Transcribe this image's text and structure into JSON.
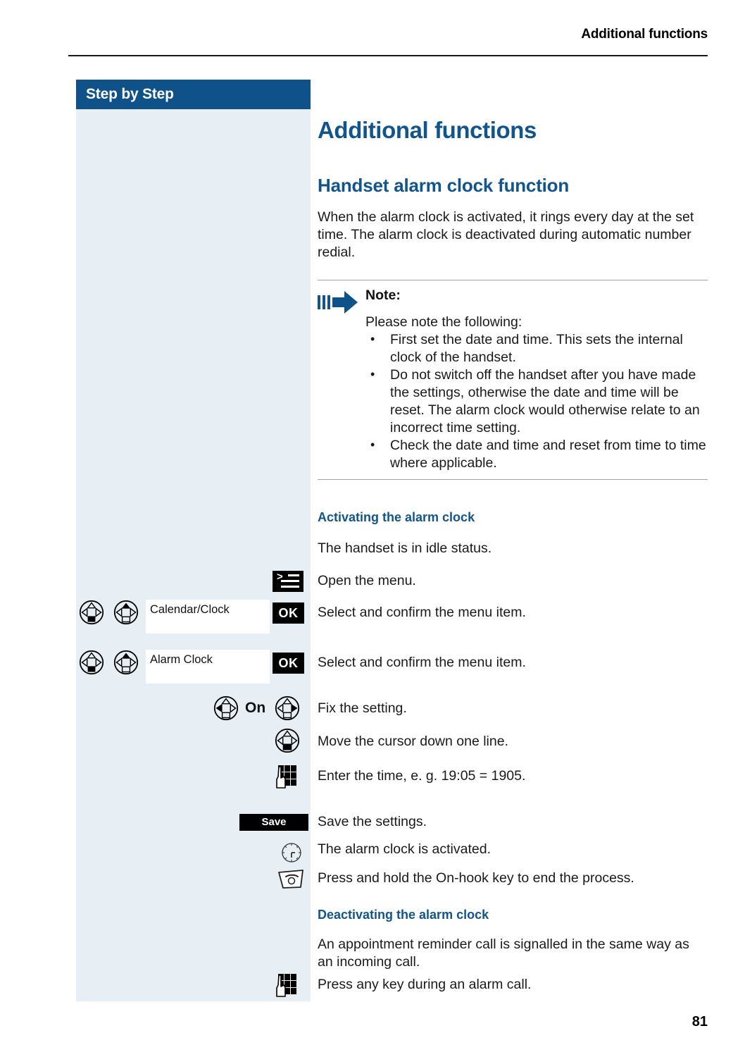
{
  "page": {
    "running_head": "Additional functions",
    "number": "81",
    "accent_blue": "#12548c",
    "header_bar_blue": "#0f5289",
    "sidebar_bg": "#e7eef4"
  },
  "sidebar": {
    "title": "Step by Step"
  },
  "main": {
    "h1": "Additional functions",
    "h2": "Handset alarm clock function",
    "intro": "When the alarm clock is activated, it rings every day at the set time. The alarm clock is deactivated during automatic number redial.",
    "note": {
      "icon": "note-arrow-icon",
      "title": "Note:",
      "lead": "Please note the following:",
      "items": [
        "First set the date and time. This sets the internal clock of the handset.",
        "Do not switch off the handset after you have made the settings, otherwise the date and time will be reset. The alarm clock would otherwise relate to an incorrect time setting.",
        "Check the date and time and reset from time to time where applicable."
      ]
    },
    "section_activate": {
      "title": "Activating the alarm clock",
      "idle_text": "The handset is in idle status.",
      "steps": [
        {
          "icon": "menu-key-icon",
          "text": "Open the menu."
        },
        {
          "icon": "navigation-key-icon",
          "display": "Calendar/Clock",
          "softkey": "OK",
          "text": "Select and confirm the menu item."
        },
        {
          "icon": "navigation-key-icon",
          "display": "Alarm Clock",
          "softkey": "OK",
          "text": "Select and confirm the menu item."
        },
        {
          "icon": "navigation-key-icon",
          "label": "On",
          "text": "Fix the setting."
        },
        {
          "icon": "navigation-key-down-icon",
          "text": "Move the cursor down one line."
        },
        {
          "icon": "keypad-icon",
          "text": "Enter the time, e. g. 19:05 = 1905."
        },
        {
          "icon": "save-softkey",
          "softkey": "Save",
          "text": "Save the settings."
        },
        {
          "icon": "alarm-clock-icon",
          "text": "The alarm clock is activated."
        },
        {
          "icon": "on-hook-key-icon",
          "text": "Press and hold the On-hook key to end the process."
        }
      ]
    },
    "section_deactivate": {
      "title": "Deactivating the alarm clock",
      "paragraph": "An appointment reminder call is signalled in the same way as an incoming call.",
      "steps": [
        {
          "icon": "keypad-icon",
          "text": "Press any key during an alarm call."
        }
      ]
    }
  }
}
